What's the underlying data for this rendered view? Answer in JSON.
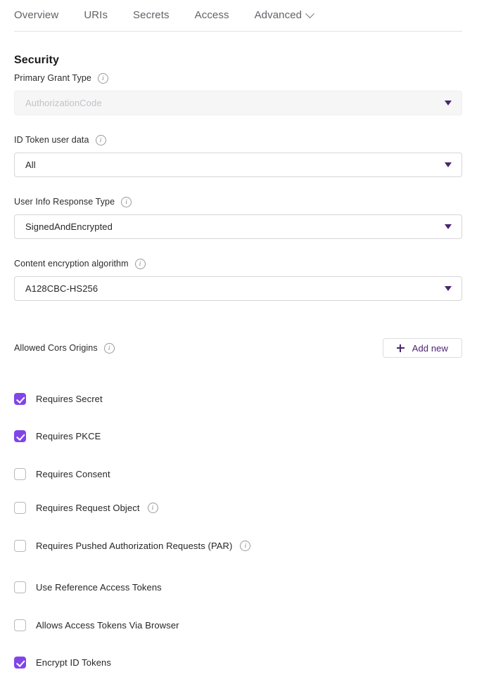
{
  "tabs": [
    {
      "label": "Overview",
      "has_caret": false
    },
    {
      "label": "URIs",
      "has_caret": false
    },
    {
      "label": "Secrets",
      "has_caret": false
    },
    {
      "label": "Access",
      "has_caret": false
    },
    {
      "label": "Advanced",
      "has_caret": true
    }
  ],
  "section": {
    "title": "Security"
  },
  "fields": [
    {
      "label": "Primary Grant Type",
      "value": "AuthorizationCode",
      "disabled": true,
      "has_info": true
    },
    {
      "label": "ID Token user data",
      "value": "All",
      "disabled": false,
      "has_info": true
    },
    {
      "label": "User Info Response Type",
      "value": "SignedAndEncrypted",
      "disabled": false,
      "has_info": true
    },
    {
      "label": "Content encryption algorithm",
      "value": "A128CBC-HS256",
      "disabled": false,
      "has_info": true
    }
  ],
  "cors": {
    "label": "Allowed Cors Origins",
    "has_info": true,
    "add_button_label": "Add new",
    "add_button_icon": "plus-icon"
  },
  "checkboxes": [
    {
      "label": "Requires Secret",
      "checked": true,
      "has_info": false
    },
    {
      "label": "Requires PKCE",
      "checked": true,
      "has_info": false
    },
    {
      "label": "Requires Consent",
      "checked": false,
      "has_info": false
    },
    {
      "label": "Requires Request Object",
      "checked": false,
      "has_info": true
    },
    {
      "label": "Requires Pushed Authorization Requests (PAR)",
      "checked": false,
      "has_info": true
    },
    {
      "label": "Use Reference Access Tokens",
      "checked": false,
      "has_info": false
    },
    {
      "label": "Allows Access Tokens Via Browser",
      "checked": false,
      "has_info": false
    },
    {
      "label": "Encrypt ID Tokens",
      "checked": true,
      "has_info": false
    }
  ],
  "colors": {
    "accent_purple": "#8245e8",
    "dark_purple": "#4a2472",
    "border_grey": "#d6d6da",
    "text_primary": "#26262a",
    "text_muted": "#5f6368",
    "disabled_bg": "#f6f6f7"
  }
}
